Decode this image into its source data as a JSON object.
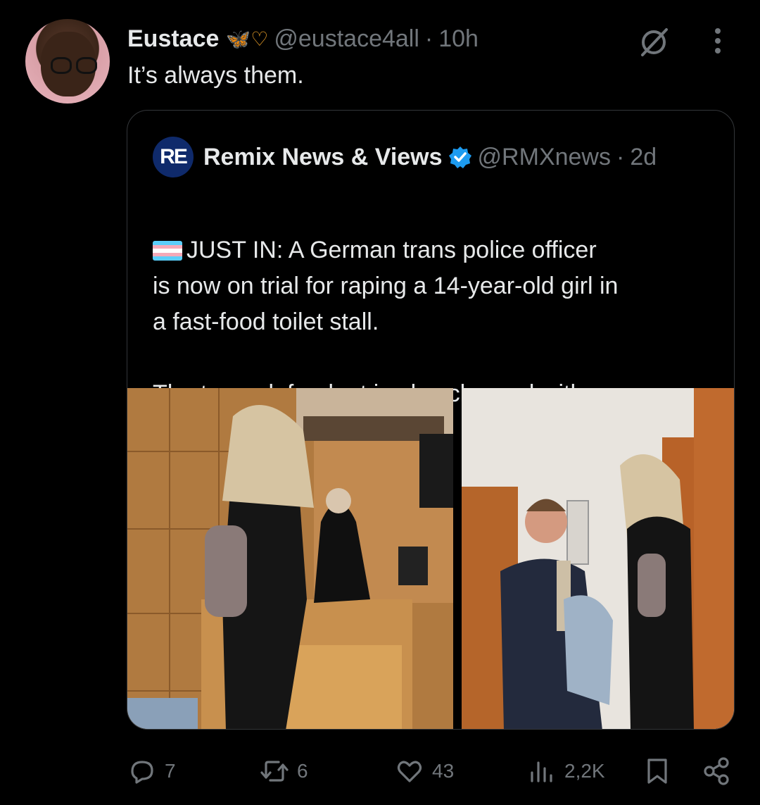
{
  "tweet": {
    "author_name": "Eustace",
    "author_emoji": "🦋♡",
    "handle": "@eustace4all",
    "separator": "·",
    "time": "10h",
    "text": "It’s always them."
  },
  "quote": {
    "avatar_text": "RE",
    "author_name": "Remix News & Views",
    "handle": "@RMXnews",
    "separator": "·",
    "time": "2d",
    "line1": "JUST IN: A German trans police officer",
    "line2": "is now on trial for raping a 14-year-old girl in",
    "line3": "a fast-food toilet stall.",
    "line4": "The trans defendant is also charged with po..."
  },
  "actions": {
    "replies": "7",
    "reposts": "6",
    "likes": "43",
    "views": "2,2K"
  },
  "colors": {
    "background": "#000000",
    "text": "#e7e9ea",
    "muted": "#71767b",
    "verified": "#1d9bf0",
    "border": "#333639"
  }
}
